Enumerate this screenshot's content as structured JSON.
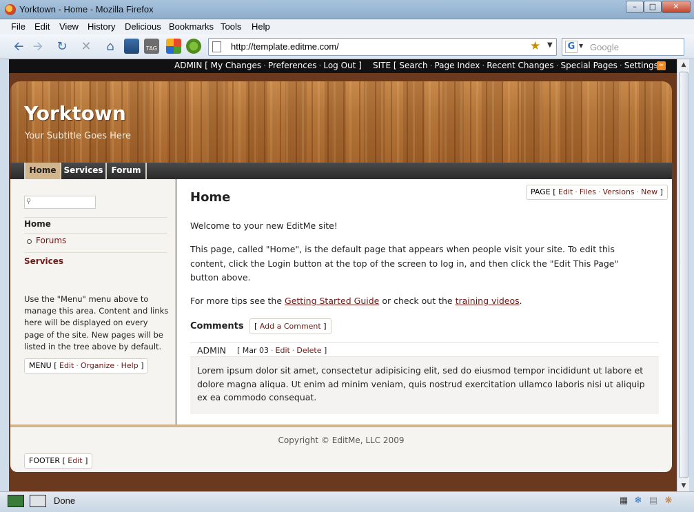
{
  "window": {
    "title": "Yorktown - Home - Mozilla Firefox"
  },
  "menubar": [
    "File",
    "Edit",
    "View",
    "History",
    "Delicious",
    "Bookmarks",
    "Tools",
    "Help"
  ],
  "address": {
    "url": "http://template.editme.com/"
  },
  "search": {
    "placeholder": "Google",
    "engine": "G"
  },
  "adminbar": {
    "admin_label": "ADMIN [",
    "admin_links": [
      "My Changes",
      "Preferences",
      "Log Out"
    ],
    "site_label": "SITE [",
    "site_links": [
      "Search",
      "Page Index",
      "Recent Changes",
      "Special Pages",
      "Settings"
    ],
    "close_bracket": "]"
  },
  "header": {
    "title": "Yorktown",
    "subtitle": "Your Subtitle Goes Here"
  },
  "tabs": [
    "Home",
    "Services",
    "Forum"
  ],
  "sidebar": {
    "home": "Home",
    "forums": "Forums",
    "services": "Services",
    "help_text": "Use the \"Menu\" menu above to manage this area. Content and links here will be displayed on every page of the site. New pages will be listed in the tree above by default.",
    "menu_box": {
      "label": "MENU [",
      "links": [
        "Edit",
        "Organize",
        "Help"
      ],
      "end": "]"
    }
  },
  "main": {
    "page_box": {
      "label": "PAGE [",
      "links": [
        "Edit",
        "Files",
        "Versions",
        "New"
      ],
      "end": "]"
    },
    "title": "Home",
    "welcome": "Welcome to your new EditMe site!",
    "intro": "This page, called \"Home\", is the default page that appears when people visit your site. To edit this content, click the Login button at the top of the screen to log in, and then click the \"Edit This Page\" button above.",
    "tips_prefix": "For more tips see the ",
    "tips_link1": "Getting Started Guide",
    "tips_middle": " or check out the ",
    "tips_link2": "training videos",
    "tips_suffix": ".",
    "comments_title": "Comments",
    "add_comment": {
      "open": "[ ",
      "link": "Add a Comment",
      "close": " ]"
    },
    "comment": {
      "author": "ADMIN",
      "date": "Mar 03",
      "links": [
        "Edit",
        "Delete"
      ],
      "body": "Lorem ipsum dolor sit amet, consectetur adipisicing elit, sed do eiusmod tempor incididunt ut labore et dolore magna aliqua. Ut enim ad minim veniam, quis nostrud exercitation ullamco laboris nisi ut aliquip ex ea commodo consequat."
    }
  },
  "footer": {
    "copyright": "Copyright © EditMe, LLC 2009",
    "box": {
      "label": "FOOTER [",
      "link": "Edit",
      "end": "]"
    }
  },
  "status": {
    "text": "Done"
  },
  "colors": {
    "accent": "#6b1a14",
    "tab_active": "#d2b58c",
    "page_bg": "#6b3a1e"
  }
}
